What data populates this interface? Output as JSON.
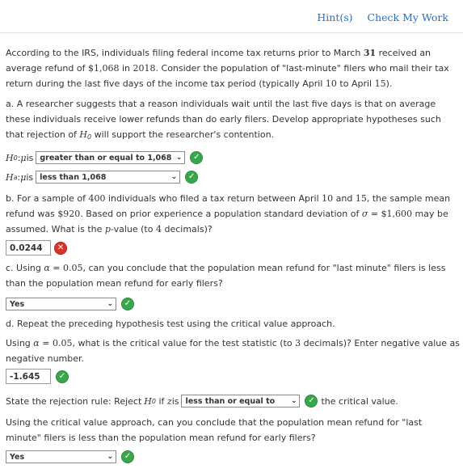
{
  "header": {
    "hint_label": "Hint(s)",
    "check_label": "Check My Work"
  },
  "intro": {
    "t1": "According to the IRS, individuals filing federal income tax returns prior to March ",
    "march_day": "31",
    "t2": " received an average refund of ",
    "refund": "$1,068",
    "t3": " in ",
    "year": "2018",
    "t4": ". Consider the population of \"last-minute\" filers who mail their tax return during the last five days of the income tax period (typically April ",
    "apr_start": "10",
    "t5": " to April ",
    "apr_end": "15",
    "t6": ")."
  },
  "part_a": {
    "text": "a. A researcher suggests that a reason individuals wait until the last five days is that on average these individuals receive lower refunds than do early filers. Develop appropriate hypotheses such that rejection of ",
    "H": "H",
    "sub0": "0",
    "text_end": " will support the researcher's contention.",
    "h0_prefix_sym": "H",
    "h0_sub": "0",
    "colon": " : ",
    "mu": "μ",
    "is": " is",
    "h0_value": "greater than or equal to 1,068",
    "ha_sub": "a",
    "ha_value": "less than 1,068"
  },
  "part_b": {
    "t1": "b. For a sample of ",
    "n": "400",
    "t2": " individuals who filed a tax return between April ",
    "d1": "10",
    "t3": " and ",
    "d2": "15",
    "t4": ", the sample mean refund was ",
    "mean": "$920",
    "t5": ". Based on prior experience a population standard deviation of ",
    "sigma": "σ",
    "eq": " = ",
    "sd": "$1,600",
    "t6": " may be assumed. What is the ",
    "p": "p",
    "t7": "-value (to ",
    "dec": "4",
    "t8": " decimals)?",
    "answer": "0.0244"
  },
  "part_c": {
    "t1": "c. Using ",
    "alpha": "α",
    "eq": " = ",
    "alpha_val": "0.05",
    "t2": ", can you conclude that the population mean refund for \"last minute\" filers is less than the population mean refund for early filers?",
    "answer": "Yes"
  },
  "part_d": {
    "heading": "d. Repeat the preceding hypothesis test using the critical value approach.",
    "t1": "Using ",
    "alpha": "α",
    "eq": " = ",
    "alpha_val": "0.05",
    "t2": ", what is the critical value for the test statistic (to ",
    "dec": "3",
    "t3": " decimals)? Enter negative value as negative number.",
    "critical_value": "-1.645",
    "rule_t1": "State the rejection rule: Reject ",
    "H": "H",
    "sub0": "0",
    "rule_t2": " if ",
    "z": "z",
    "rule_t3": " is",
    "rule_value": "less than or equal to",
    "rule_t4": "the critical value.",
    "q": "Using the critical value approach, can you conclude that the population mean refund for \"last minute\" filers is less than the population mean refund for early filers?",
    "answer": "Yes"
  },
  "icons": {
    "correct": "check-circle-icon",
    "incorrect": "x-circle-icon",
    "dropdown": "chevron-down-icon"
  },
  "colors": {
    "link": "#2a6ebb",
    "correct": "#3aa64b",
    "incorrect": "#d9342b"
  }
}
